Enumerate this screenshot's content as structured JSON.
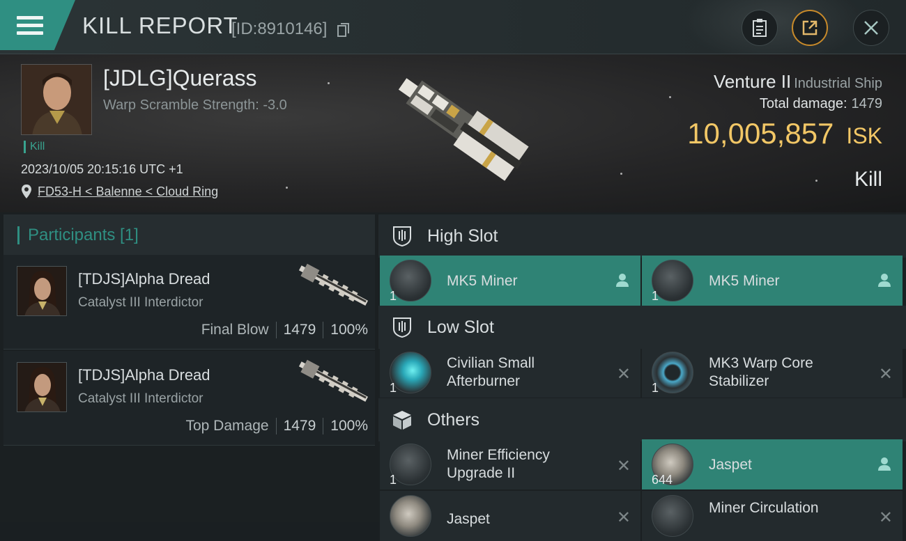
{
  "header": {
    "title": "KILL REPORT",
    "report_id": "[ID:8910146]"
  },
  "victim": {
    "name": "[JDLG]Querass",
    "warp_scramble": "Warp Scramble Strength: -3.0",
    "tag": "Kill",
    "timestamp": "2023/10/05 20:15:16 UTC +1",
    "location": "FD53-H < Balenne < Cloud Ring",
    "ship_name": "Venture II",
    "ship_class": "Industrial Ship",
    "total_damage_label": "Total damage:",
    "total_damage_value": "1479",
    "isk_value": "10,005,857",
    "isk_unit": "ISK",
    "kill_label": "Kill"
  },
  "participants": {
    "header": "Participants [1]",
    "rows": [
      {
        "name": "[TDJS]Alpha Dread",
        "ship": "Catalyst III Interdictor",
        "role": "Final Blow",
        "damage": "1479",
        "percent": "100%"
      },
      {
        "name": "[TDJS]Alpha Dread",
        "ship": "Catalyst III Interdictor",
        "role": "Top Damage",
        "damage": "1479",
        "percent": "100%"
      }
    ]
  },
  "slots": {
    "high": {
      "label": "High Slot",
      "items": [
        {
          "name": "MK5 Miner",
          "qty": "1"
        },
        {
          "name": "MK5 Miner",
          "qty": "1"
        }
      ]
    },
    "low": {
      "label": "Low Slot",
      "items": [
        {
          "line1": "Civilian Small",
          "line2": "Afterburner",
          "qty": "1"
        },
        {
          "line1": "MK3 Warp Core",
          "line2": "Stabilizer",
          "qty": "1"
        }
      ]
    },
    "others": {
      "label": "Others",
      "items": [
        {
          "line1": "Miner Efficiency",
          "line2": "Upgrade II",
          "qty": "1"
        },
        {
          "name": "Jaspet",
          "qty": "644"
        },
        {
          "name": "Jaspet",
          "qty": ""
        },
        {
          "name": "Miner Circulation",
          "qty": ""
        }
      ]
    }
  },
  "icons": [
    "menu-icon",
    "copy-icon",
    "clipboard-icon",
    "share-icon",
    "close-icon",
    "location-pin-icon",
    "slot-icon",
    "cube-icon",
    "user-icon",
    "remove-icon"
  ],
  "colors": {
    "accent": "#2f8f82",
    "isk": "#f2c766",
    "share_ring": "#c88a2a"
  }
}
